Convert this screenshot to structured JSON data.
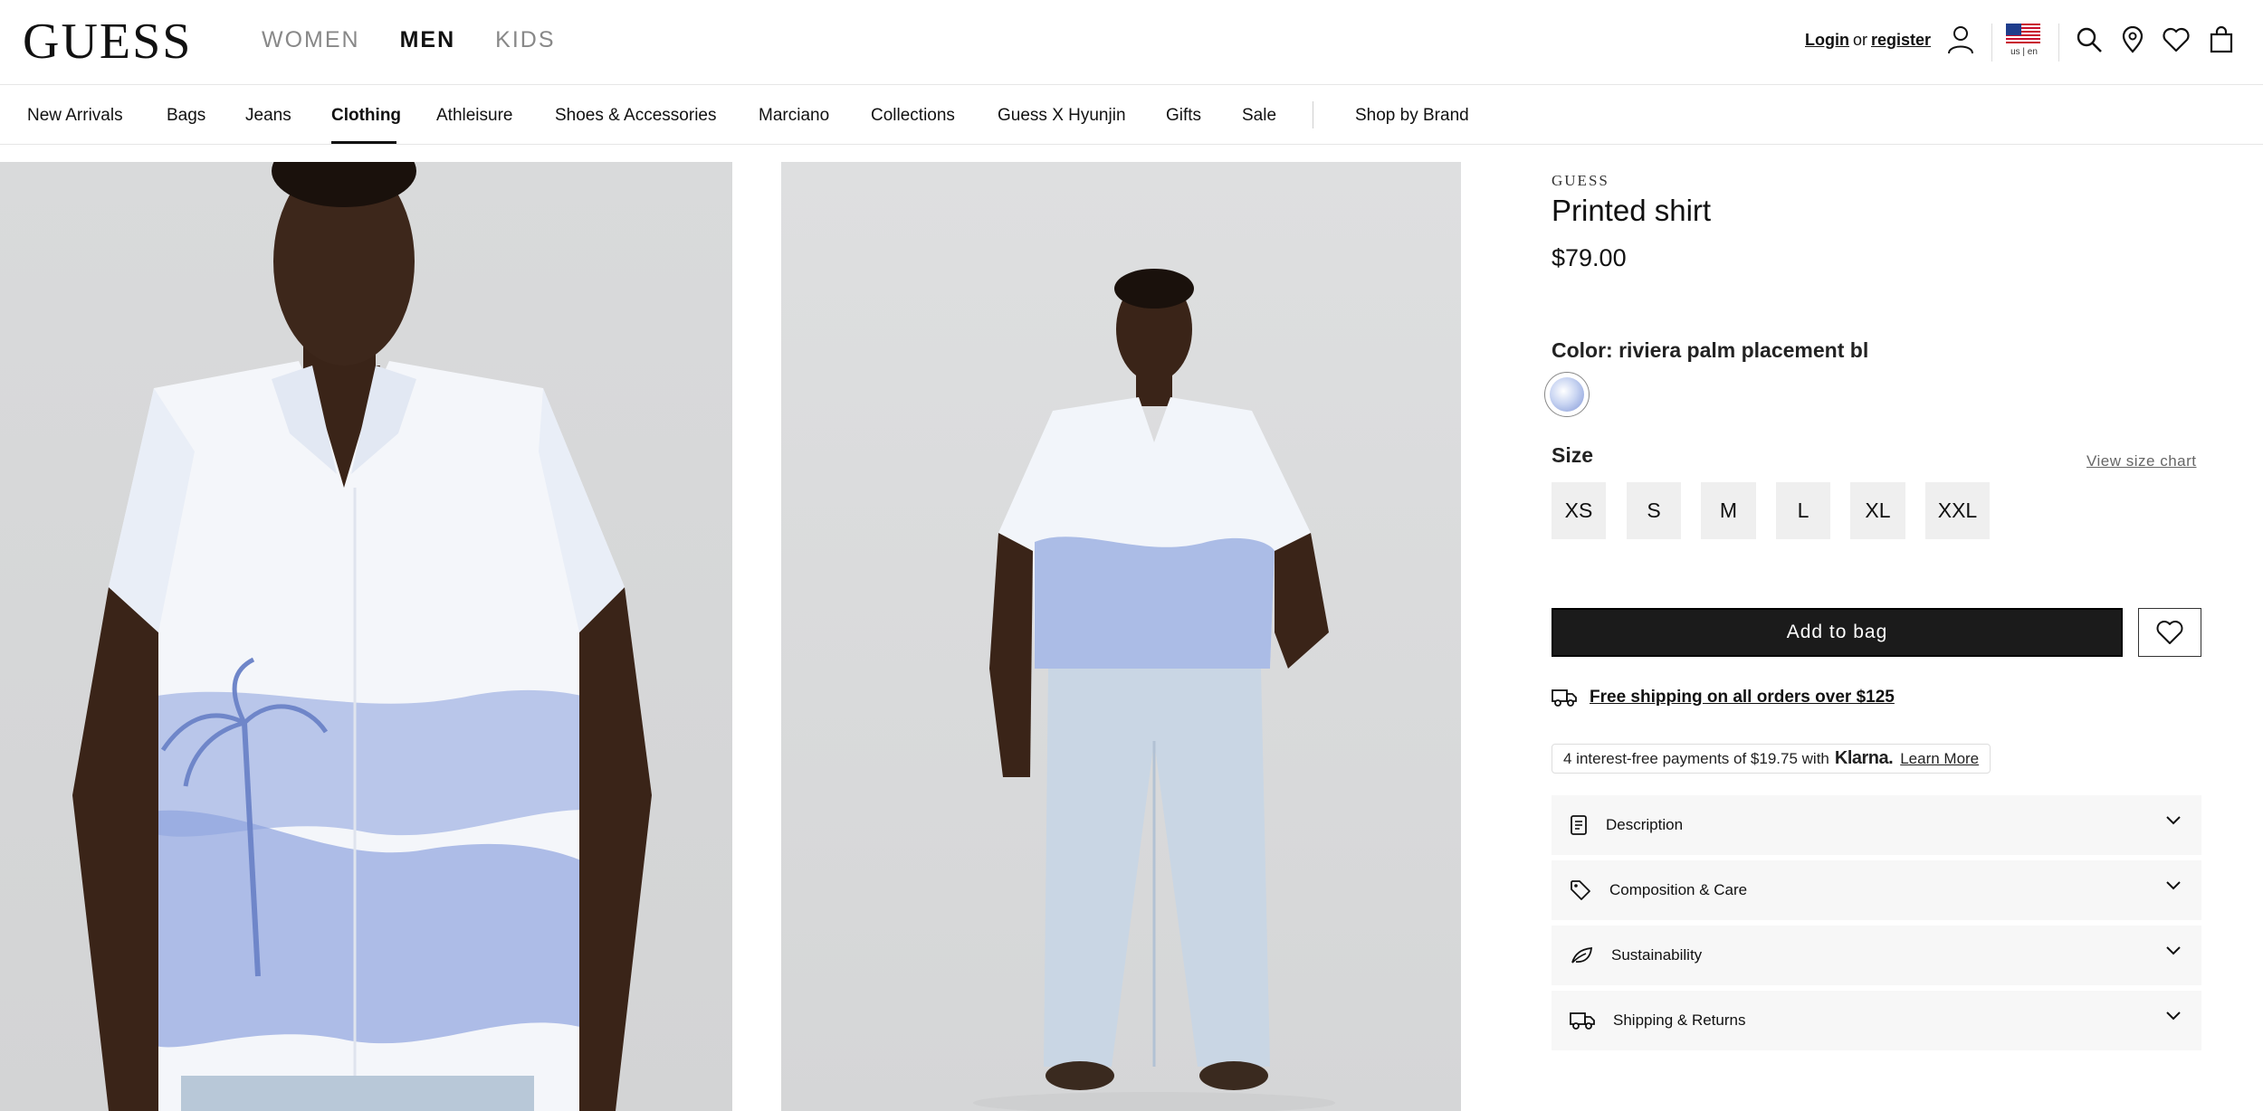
{
  "header": {
    "logo": "GUESS",
    "gender_nav": [
      "WOMEN",
      "MEN",
      "KIDS"
    ],
    "gender_active": "MEN",
    "login": "Login",
    "or": "or",
    "register": "register",
    "locale": "us | en",
    "icons": [
      "user-icon",
      "us-flag-icon",
      "search-icon",
      "store-locator-icon",
      "wishlist-heart-icon",
      "shopping-bag-icon"
    ]
  },
  "category_nav": {
    "items": [
      "New Arrivals",
      "Bags",
      "Jeans",
      "Clothing",
      "Athleisure",
      "Shoes & Accessories",
      "Marciano",
      "Collections",
      "Guess X Hyunjin",
      "Gifts",
      "Sale",
      "Shop by Brand"
    ],
    "active": "Clothing"
  },
  "product": {
    "brand": "GUESS",
    "title": "Printed shirt",
    "price": "$79.00",
    "color_label": "Color: riviera palm placement bl",
    "size_label": "Size",
    "size_chart_link": "View size chart",
    "sizes": [
      "XS",
      "S",
      "M",
      "L",
      "XL",
      "XXL"
    ],
    "add_to_bag": "Add to bag",
    "shipping_text": "Free shipping on all orders over $125",
    "klarna": {
      "prefix": "4 interest-free payments of $19.75 with",
      "logo": "Klarna.",
      "learn_more": "Learn More"
    },
    "accordions": [
      {
        "label": "Description",
        "icon": "document-icon"
      },
      {
        "label": "Composition & Care",
        "icon": "tag-icon"
      },
      {
        "label": "Sustainability",
        "icon": "leaf-icon"
      },
      {
        "label": "Shipping & Returns",
        "icon": "truck-icon"
      }
    ]
  },
  "colors": {
    "text": "#111111",
    "button_bg": "#1b1b1b",
    "size_bg": "#efefef",
    "accordion_bg": "#f7f7f7",
    "shirt_print": "#8fa4de"
  }
}
